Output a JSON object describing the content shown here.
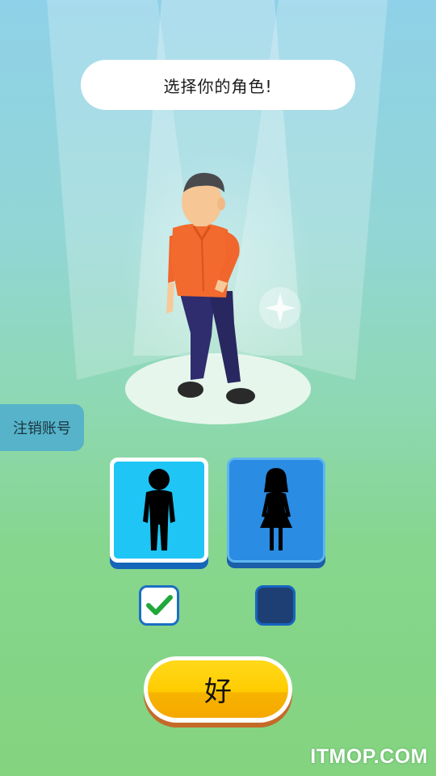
{
  "header": {
    "prompt": "选择你的角色!"
  },
  "sidebar": {
    "logout_label": "注销账号"
  },
  "characters": [
    {
      "id": "male",
      "icon": "male-silhouette-icon",
      "selected": true
    },
    {
      "id": "female",
      "icon": "female-silhouette-icon",
      "selected": false
    }
  ],
  "actions": {
    "confirm_label": "好"
  },
  "watermark": {
    "text": "ITMOP.COM"
  },
  "colors": {
    "selected_card": "#1fc5f5",
    "unselected_card": "#2a8ce3",
    "confirm_button": "#ffcc00",
    "check_mark": "#22a83a"
  }
}
